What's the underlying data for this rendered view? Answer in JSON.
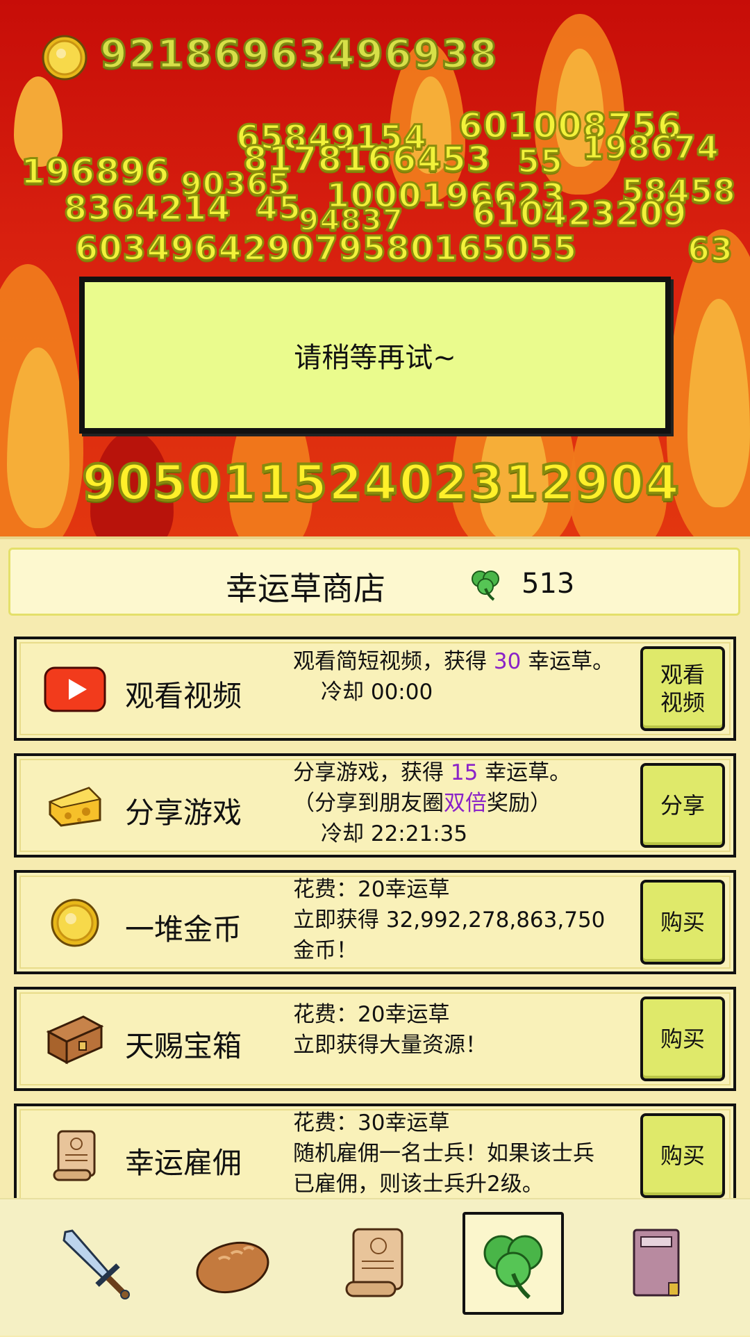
{
  "hud": {
    "gold_amount": "92186963496938"
  },
  "floating_numbers": [
    "65849154",
    "601008756",
    "196896",
    "8178166453",
    "55",
    "198674",
    "90365",
    "1000196623",
    "58458",
    "8364214",
    "45",
    "94837",
    "610423209",
    "6034964",
    "29079580165055",
    "63"
  ],
  "big_number": "90501152402312904",
  "toast": {
    "message": "请稍等再试~"
  },
  "shop": {
    "title": "幸运草商店",
    "clover_count": "513",
    "items": [
      {
        "name": "观看视频",
        "icon": "video-play-icon",
        "desc_line1_pre": "观看简短视频，获得 ",
        "desc_line1_highlight": "30",
        "desc_line1_post": " 幸运草。",
        "desc_line2": "冷却 00:00",
        "button": "观看视频"
      },
      {
        "name": "分享游戏",
        "icon": "cheese-icon",
        "desc_line1_pre": "分享游戏，获得 ",
        "desc_line1_highlight": "15",
        "desc_line1_post": " 幸运草。",
        "desc_line2_pre": "（分享到朋友圈",
        "desc_line2_highlight": "双倍",
        "desc_line2_post": "奖励）",
        "desc_line3": "冷却 22:21:35",
        "button": "分享"
      },
      {
        "name": "一堆金币",
        "icon": "gold-coin-icon",
        "desc_line1": "花费：20幸运草",
        "desc_line2": "立即获得 32,992,278,863,750",
        "desc_line3": "金币！",
        "button": "购买"
      },
      {
        "name": "天赐宝箱",
        "icon": "treasure-chest-icon",
        "desc_line1": "花费：20幸运草",
        "desc_line2": "立即获得大量资源！",
        "button": "购买"
      },
      {
        "name": "幸运雇佣",
        "icon": "scroll-icon",
        "desc_line1": "花费：30幸运草",
        "desc_line2": "随机雇佣一名士兵！如果该士兵",
        "desc_line3": "已雇佣，则该士兵升2级。",
        "button": "购买"
      }
    ]
  },
  "nav": {
    "tabs": [
      {
        "icon": "sword-icon"
      },
      {
        "icon": "bread-icon"
      },
      {
        "icon": "scroll-icon"
      },
      {
        "icon": "clover-icon",
        "active": true
      },
      {
        "icon": "book-icon"
      }
    ]
  },
  "colors": {
    "highlight_purple": "#8a22c8",
    "button_green": "#dfe96a",
    "panel_bg": "#f6ebb0",
    "toast_bg": "#eafb8d"
  }
}
